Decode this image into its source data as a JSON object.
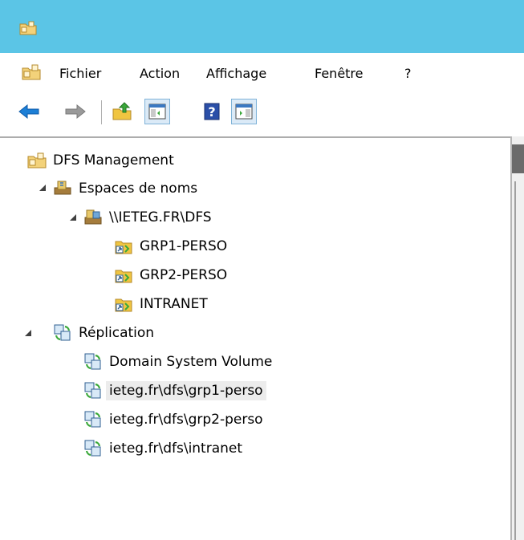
{
  "window": {
    "icon": "dfs-management-icon"
  },
  "menu": {
    "items": [
      {
        "label": "Fichier"
      },
      {
        "label": "Action"
      },
      {
        "label": "Affichage"
      },
      {
        "label": "Fenêtre"
      },
      {
        "label": "?"
      }
    ]
  },
  "toolbar": {
    "buttons": [
      {
        "icon": "back-arrow-icon"
      },
      {
        "icon": "forward-arrow-icon"
      },
      {
        "icon": "up-folder-icon"
      },
      {
        "icon": "show-hide-console-tree-icon"
      },
      {
        "icon": "help-icon"
      },
      {
        "icon": "show-hide-action-pane-icon"
      }
    ]
  },
  "tree": {
    "root": {
      "label": "DFS Management"
    },
    "namespaces": {
      "label": "Espaces de noms",
      "namespace": {
        "label": "\\\\IETEG.FR\\DFS",
        "folders": [
          {
            "label": "GRP1-PERSO"
          },
          {
            "label": "GRP2-PERSO"
          },
          {
            "label": "INTRANET"
          }
        ]
      }
    },
    "replication": {
      "label": "Réplication",
      "groups": [
        {
          "label": "Domain System Volume"
        },
        {
          "label": "ieteg.fr\\dfs\\grp1-perso",
          "selected": true
        },
        {
          "label": "ieteg.fr\\dfs\\grp2-perso"
        },
        {
          "label": "ieteg.fr\\dfs\\intranet"
        }
      ]
    }
  },
  "colors": {
    "titlebar": "#5bc5e6",
    "selection": "#ececec",
    "arrow_blue": "#1c7fd6"
  }
}
